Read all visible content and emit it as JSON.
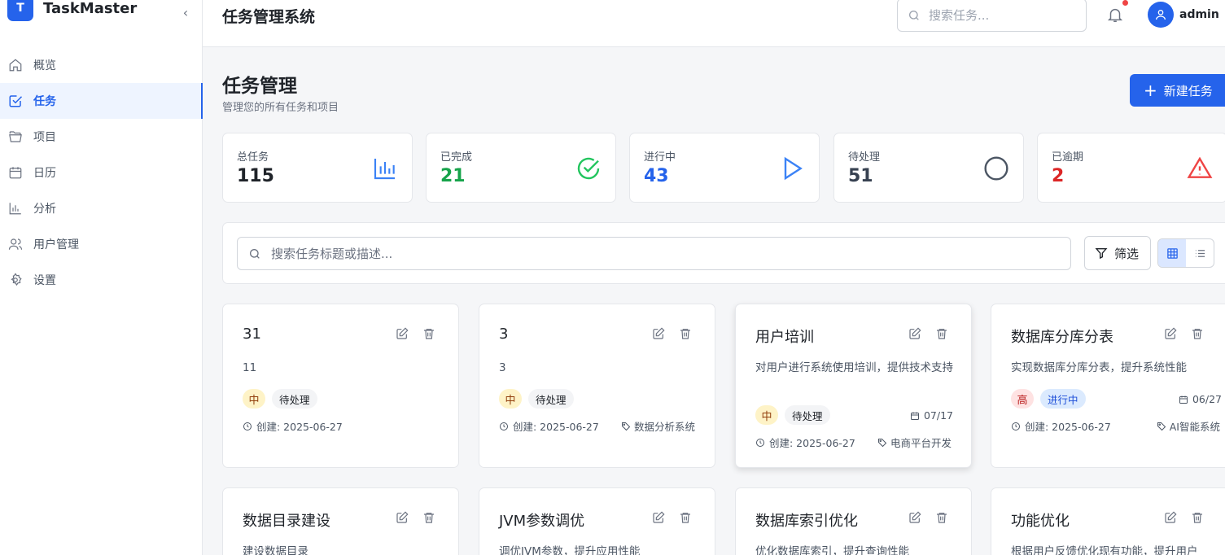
{
  "app": {
    "logo_letter": "T",
    "name": "TaskMaster",
    "collapse_icon": "chevron-left-icon"
  },
  "sidebar": {
    "items": [
      {
        "label": "概览",
        "icon": "home-icon"
      },
      {
        "label": "任务",
        "icon": "checkbox-icon",
        "active": true
      },
      {
        "label": "项目",
        "icon": "folder-icon"
      },
      {
        "label": "日历",
        "icon": "calendar-icon"
      },
      {
        "label": "分析",
        "icon": "bar-chart-icon"
      },
      {
        "label": "用户管理",
        "icon": "users-icon"
      },
      {
        "label": "设置",
        "icon": "gear-icon"
      }
    ]
  },
  "header": {
    "title": "任务管理系统",
    "search_placeholder": "搜索任务...",
    "notification_dot": true,
    "username": "admin"
  },
  "page": {
    "title": "任务管理",
    "subtitle": "管理您的所有任务和项目",
    "new_button": "新建任务"
  },
  "stats": [
    {
      "label": "总任务",
      "value": "115",
      "color": "#1f2329",
      "icon": "bar-chart-icon",
      "icon_color": "#3b82f6"
    },
    {
      "label": "已完成",
      "value": "21",
      "color": "#16a34a",
      "icon": "check-circle-icon",
      "icon_color": "#22c55e"
    },
    {
      "label": "进行中",
      "value": "43",
      "color": "#2563eb",
      "icon": "play-icon",
      "icon_color": "#3b82f6"
    },
    {
      "label": "待处理",
      "value": "51",
      "color": "#374151",
      "icon": "circle-icon",
      "icon_color": "#4b5563"
    },
    {
      "label": "已逾期",
      "value": "2",
      "color": "#dc2626",
      "icon": "alert-triangle-icon",
      "icon_color": "#ef4444"
    }
  ],
  "filter": {
    "search_placeholder": "搜索任务标题或描述...",
    "filter_label": "筛选",
    "view_mode": "grid"
  },
  "cards": [
    {
      "title": "31",
      "desc": "11",
      "priority": "中",
      "status": "待处理",
      "due": "",
      "created": "创建: 2025-06-27",
      "project": ""
    },
    {
      "title": "3",
      "desc": "3",
      "priority": "中",
      "status": "待处理",
      "due": "",
      "created": "创建: 2025-06-27",
      "project": "数据分析系统"
    },
    {
      "title": "用户培训",
      "desc": "对用户进行系统使用培训，提供技术支持",
      "priority": "中",
      "status": "待处理",
      "due": "07/17",
      "created": "创建: 2025-06-27",
      "project": "电商平台开发"
    },
    {
      "title": "数据库分库分表",
      "desc": "实现数据库分库分表，提升系统性能",
      "priority": "高",
      "status": "进行中",
      "due": "06/27",
      "created": "创建: 2025-06-27",
      "project": "AI智能系统"
    },
    {
      "title": "数据目录建设",
      "desc": "建设数据目录"
    },
    {
      "title": "JVM参数调优",
      "desc": "调优JVM参数，提升应用性能"
    },
    {
      "title": "数据库索引优化",
      "desc": "优化数据库索引，提升查询性能"
    },
    {
      "title": "功能优化",
      "desc": "根据用户反馈优化现有功能，提升用户"
    }
  ]
}
